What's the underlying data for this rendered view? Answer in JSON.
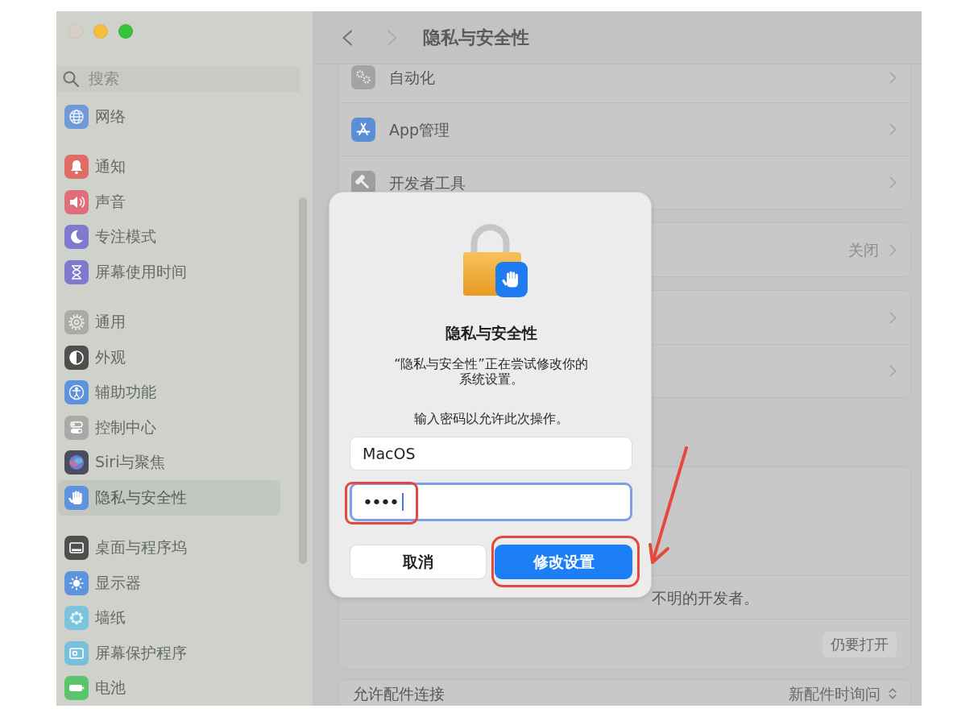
{
  "window": {
    "controls": [
      {
        "kind": "close",
        "disabled": true
      },
      {
        "kind": "minimize",
        "disabled": false
      },
      {
        "kind": "zoom",
        "disabled": false
      }
    ]
  },
  "sidebar": {
    "search": {
      "placeholder": "搜索"
    },
    "groups": [
      {
        "items": [
          {
            "label": "网络",
            "selected": false
          }
        ]
      },
      {
        "items": [
          {
            "label": "通知",
            "selected": false
          },
          {
            "label": "声音",
            "selected": false
          },
          {
            "label": "专注模式",
            "selected": false
          },
          {
            "label": "屏幕使用时间",
            "selected": false
          }
        ]
      },
      {
        "items": [
          {
            "label": "通用",
            "selected": false
          },
          {
            "label": "外观",
            "selected": false
          },
          {
            "label": "辅助功能",
            "selected": false
          },
          {
            "label": "控制中心",
            "selected": false
          },
          {
            "label": "Siri与聚焦",
            "selected": false
          },
          {
            "label": "隐私与安全性",
            "selected": true
          }
        ]
      },
      {
        "items": [
          {
            "label": "桌面与程序坞",
            "selected": false
          },
          {
            "label": "显示器",
            "selected": false
          },
          {
            "label": "墙纸",
            "selected": false
          },
          {
            "label": "屏幕保护程序",
            "selected": false
          },
          {
            "label": "电池",
            "selected": false
          }
        ]
      }
    ]
  },
  "toolbar": {
    "back": {
      "disabled": false
    },
    "forward": {
      "disabled": true
    },
    "title": "隐私与安全性"
  },
  "content": {
    "cards": [
      {
        "rows": [
          {
            "kind": "link",
            "label": "自动化"
          },
          {
            "kind": "link",
            "label": "App管理"
          },
          {
            "kind": "link",
            "label": "开发者工具"
          }
        ]
      },
      {
        "rows": [
          {
            "kind": "link",
            "value": "关闭"
          }
        ]
      },
      {
        "rows": [
          {
            "kind": "link"
          },
          {
            "kind": "link"
          }
        ]
      },
      {
        "rows": [
          {
            "kind": "blank"
          },
          {
            "kind": "note",
            "text": "不明的开发者。"
          },
          {
            "kind": "action",
            "button": "仍要打开"
          }
        ]
      },
      {
        "rows": [
          {
            "kind": "popup",
            "label": "允许配件连接",
            "value": "新配件时询问"
          }
        ]
      }
    ]
  },
  "dialog": {
    "title": "隐私与安全性",
    "message": "“隐私与安全性”正在尝试修改你的系统设置。",
    "prompt": "输入密码以允许此次操作。",
    "fields": [
      {
        "kind": "text",
        "value": "MacOS",
        "focused": false
      },
      {
        "kind": "password",
        "value": "••••",
        "focused": true
      }
    ],
    "buttons": [
      {
        "label": "取消",
        "default": false
      },
      {
        "label": "修改设置",
        "default": true
      }
    ]
  }
}
